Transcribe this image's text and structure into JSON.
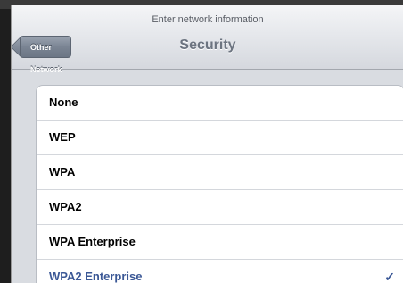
{
  "header": {
    "prompt": "Enter network information",
    "title": "Security",
    "back_label": "Other Network"
  },
  "security_options": [
    {
      "label": "None",
      "selected": false
    },
    {
      "label": "WEP",
      "selected": false
    },
    {
      "label": "WPA",
      "selected": false
    },
    {
      "label": "WPA2",
      "selected": false
    },
    {
      "label": "WPA Enterprise",
      "selected": false
    },
    {
      "label": "WPA2 Enterprise",
      "selected": true
    }
  ],
  "checkmark": "✓",
  "colors": {
    "selected_text": "#3b5896",
    "background": "#d9dce1"
  }
}
